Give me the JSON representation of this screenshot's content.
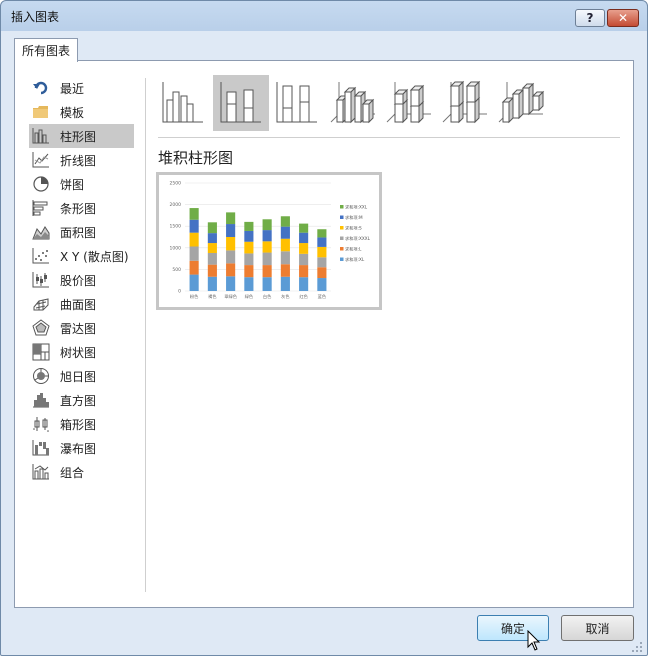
{
  "window": {
    "title": "插入图表"
  },
  "titlebar": {
    "help_label": "?",
    "close_label": "✕"
  },
  "tabs": [
    {
      "label": "所有图表"
    }
  ],
  "sidebar": {
    "items": [
      {
        "label": "最近",
        "icon": "undo-arrow-icon"
      },
      {
        "label": "模板",
        "icon": "folder-icon"
      },
      {
        "label": "柱形图",
        "icon": "column-chart-icon",
        "selected": true
      },
      {
        "label": "折线图",
        "icon": "line-chart-icon"
      },
      {
        "label": "饼图",
        "icon": "pie-chart-icon"
      },
      {
        "label": "条形图",
        "icon": "bar-chart-icon"
      },
      {
        "label": "面积图",
        "icon": "area-chart-icon"
      },
      {
        "label": "X Y (散点图)",
        "icon": "scatter-chart-icon"
      },
      {
        "label": "股价图",
        "icon": "stock-chart-icon"
      },
      {
        "label": "曲面图",
        "icon": "surface-chart-icon"
      },
      {
        "label": "雷达图",
        "icon": "radar-chart-icon"
      },
      {
        "label": "树状图",
        "icon": "treemap-chart-icon"
      },
      {
        "label": "旭日图",
        "icon": "sunburst-chart-icon"
      },
      {
        "label": "直方图",
        "icon": "histogram-chart-icon"
      },
      {
        "label": "箱形图",
        "icon": "box-whisker-chart-icon"
      },
      {
        "label": "瀑布图",
        "icon": "waterfall-chart-icon"
      },
      {
        "label": "组合",
        "icon": "combo-chart-icon"
      }
    ]
  },
  "chart_types": {
    "items": [
      {
        "icon": "clustered-column-icon"
      },
      {
        "icon": "stacked-column-icon",
        "selected": true
      },
      {
        "icon": "100-stacked-column-icon"
      },
      {
        "icon": "3d-clustered-column-icon"
      },
      {
        "icon": "3d-stacked-column-icon"
      },
      {
        "icon": "3d-100-stacked-column-icon"
      },
      {
        "icon": "3d-column-icon"
      }
    ]
  },
  "main": {
    "chart_title": "堆积柱形图"
  },
  "preview": {
    "chart_data": {
      "type": "bar",
      "stacked": true,
      "categories": [
        "粉色",
        "褐色",
        "翠绿色",
        "绿色",
        "白色",
        "灰色",
        "红色",
        "蓝色"
      ],
      "ylim": [
        0,
        2500
      ],
      "yticks": [
        0,
        500,
        1000,
        1500,
        2000,
        2500
      ],
      "grid": true,
      "legend_position": "right",
      "series": [
        {
          "name": "求和项:XL",
          "color": "#5b9bd5",
          "values": [
            380,
            330,
            340,
            320,
            320,
            330,
            320,
            300
          ]
        },
        {
          "name": "求和项:L",
          "color": "#ed7d31",
          "values": [
            320,
            280,
            300,
            280,
            280,
            290,
            280,
            250
          ]
        },
        {
          "name": "求和项:XXXL",
          "color": "#a5a5a5",
          "values": [
            330,
            270,
            300,
            270,
            290,
            300,
            260,
            230
          ]
        },
        {
          "name": "求和项:S",
          "color": "#ffc000",
          "values": [
            320,
            230,
            310,
            270,
            260,
            290,
            250,
            240
          ]
        },
        {
          "name": "求和项:M",
          "color": "#4472c4",
          "values": [
            300,
            230,
            300,
            250,
            260,
            280,
            240,
            220
          ]
        },
        {
          "name": "求和项:XXL",
          "color": "#70ad47",
          "values": [
            270,
            250,
            270,
            210,
            250,
            240,
            210,
            190
          ]
        }
      ]
    }
  },
  "footer": {
    "ok_label": "确定",
    "cancel_label": "取消"
  }
}
